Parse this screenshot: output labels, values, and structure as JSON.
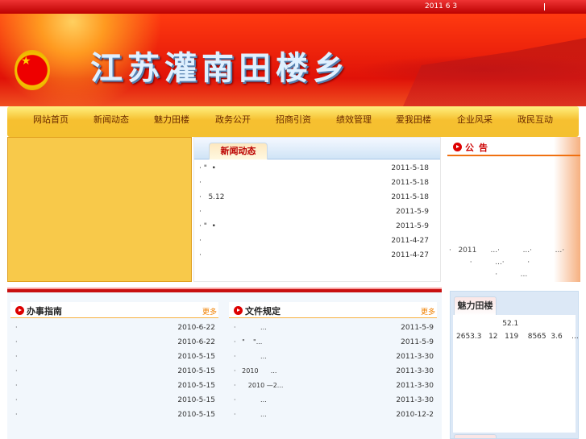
{
  "topbar": {
    "date": "2011 6 3"
  },
  "banner": {
    "title": "江苏灌南田楼乡"
  },
  "nav": [
    "网站首页",
    "新闻动态",
    "魅力田楼",
    "政务公开",
    "招商引资",
    "绩效管理",
    "爱我田楼",
    "企业风采",
    "政民互动"
  ],
  "news": {
    "tab": "新闻动态",
    "items": [
      {
        "t": "· \"  •",
        "d": "2011-5-18"
      },
      {
        "t": "·",
        "d": "2011-5-18"
      },
      {
        "t": "·   5.12",
        "d": "2011-5-18"
      },
      {
        "t": "·",
        "d": "2011-5-9"
      },
      {
        "t": "· \"  •",
        "d": "2011-5-9"
      },
      {
        "t": "·",
        "d": "2011-4-27"
      },
      {
        "t": "·",
        "d": "2011-4-27"
      }
    ]
  },
  "notice": {
    "title": "公告",
    "lines": [
      "·   2011      ...·          ...·          ...·",
      "         ·          ...·          ·",
      "                    ·          ..."
    ]
  },
  "guide": {
    "title": "办事指南",
    "more": "更多",
    "items": [
      {
        "t": "·",
        "d": "2010-6-22"
      },
      {
        "t": "·",
        "d": "2010-6-22"
      },
      {
        "t": "·",
        "d": "2010-5-15"
      },
      {
        "t": "·",
        "d": "2010-5-15"
      },
      {
        "t": "·",
        "d": "2010-5-15"
      },
      {
        "t": "·",
        "d": "2010-5-15"
      },
      {
        "t": "·",
        "d": "2010-5-15"
      }
    ]
  },
  "docs": {
    "title": "文件规定",
    "more": "更多",
    "items": [
      {
        "t": "·            ...",
        "d": "2011-5-9"
      },
      {
        "t": "·   \"    \"...",
        "d": "2011-5-9"
      },
      {
        "t": "·            ...",
        "d": "2011-3-30"
      },
      {
        "t": "·   2010      ...",
        "d": "2011-3-30"
      },
      {
        "t": "·      2010 —2...",
        "d": "2011-3-30"
      },
      {
        "t": "·            ...",
        "d": "2011-3-30"
      },
      {
        "t": "·            ...",
        "d": "2010-12-2"
      }
    ]
  },
  "charm": {
    "tab": "魅力田楼",
    "lines": [
      "                    52.1",
      "2653.3   12   119    8565  3.6    ..."
    ]
  }
}
